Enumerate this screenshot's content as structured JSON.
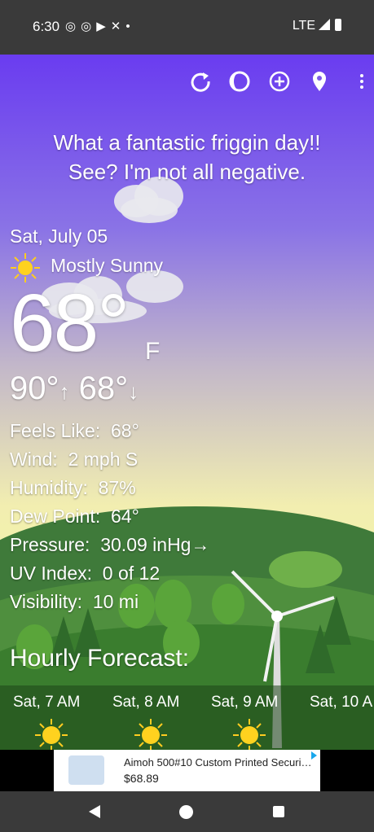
{
  "status": {
    "time": "6:30",
    "notification_icons": [
      "instagram-icon",
      "instagram-icon",
      "youtube-icon",
      "shuffle-icon",
      "dot-icon"
    ],
    "network": "LTE"
  },
  "toolbar": {
    "icons": [
      "refresh-icon",
      "theme-icon",
      "add-location-icon",
      "location-pin-icon",
      "more-vert-icon"
    ]
  },
  "headline": {
    "line1": "What a fantastic friggin day!!",
    "line2": "See? I'm not all negative."
  },
  "current": {
    "date": "Sat, July 05",
    "condition": "Mostly Sunny",
    "temperature": "68°",
    "unit": "F",
    "high": "90°",
    "low": "68°",
    "details": [
      {
        "label": "Feels Like:",
        "value": "68°"
      },
      {
        "label": "Wind:",
        "value": "2 mph S"
      },
      {
        "label": "Humidity:",
        "value": "87%"
      },
      {
        "label": "Dew Point:",
        "value": "64°"
      },
      {
        "label": "Pressure:",
        "value": "30.09 inHg"
      },
      {
        "label": "UV Index:",
        "value": "0 of 12"
      },
      {
        "label": "Visibility:",
        "value": "10 mi"
      }
    ],
    "pressure_trend": "→"
  },
  "hourly": {
    "title": "Hourly Forecast:",
    "items": [
      {
        "time": "Sat, 7 AM"
      },
      {
        "time": "Sat, 8 AM"
      },
      {
        "time": "Sat, 9 AM"
      },
      {
        "time": "Sat, 10 A"
      }
    ]
  },
  "ad": {
    "title": "Aimoh 500#10 Custom Printed Securi…",
    "price": "$68.89"
  },
  "colors": {
    "sky_top": "#6a3cf0",
    "sky_bottom": "#f4f6a8",
    "sun": "#ffd21f",
    "hill": "#4f8f3e"
  }
}
